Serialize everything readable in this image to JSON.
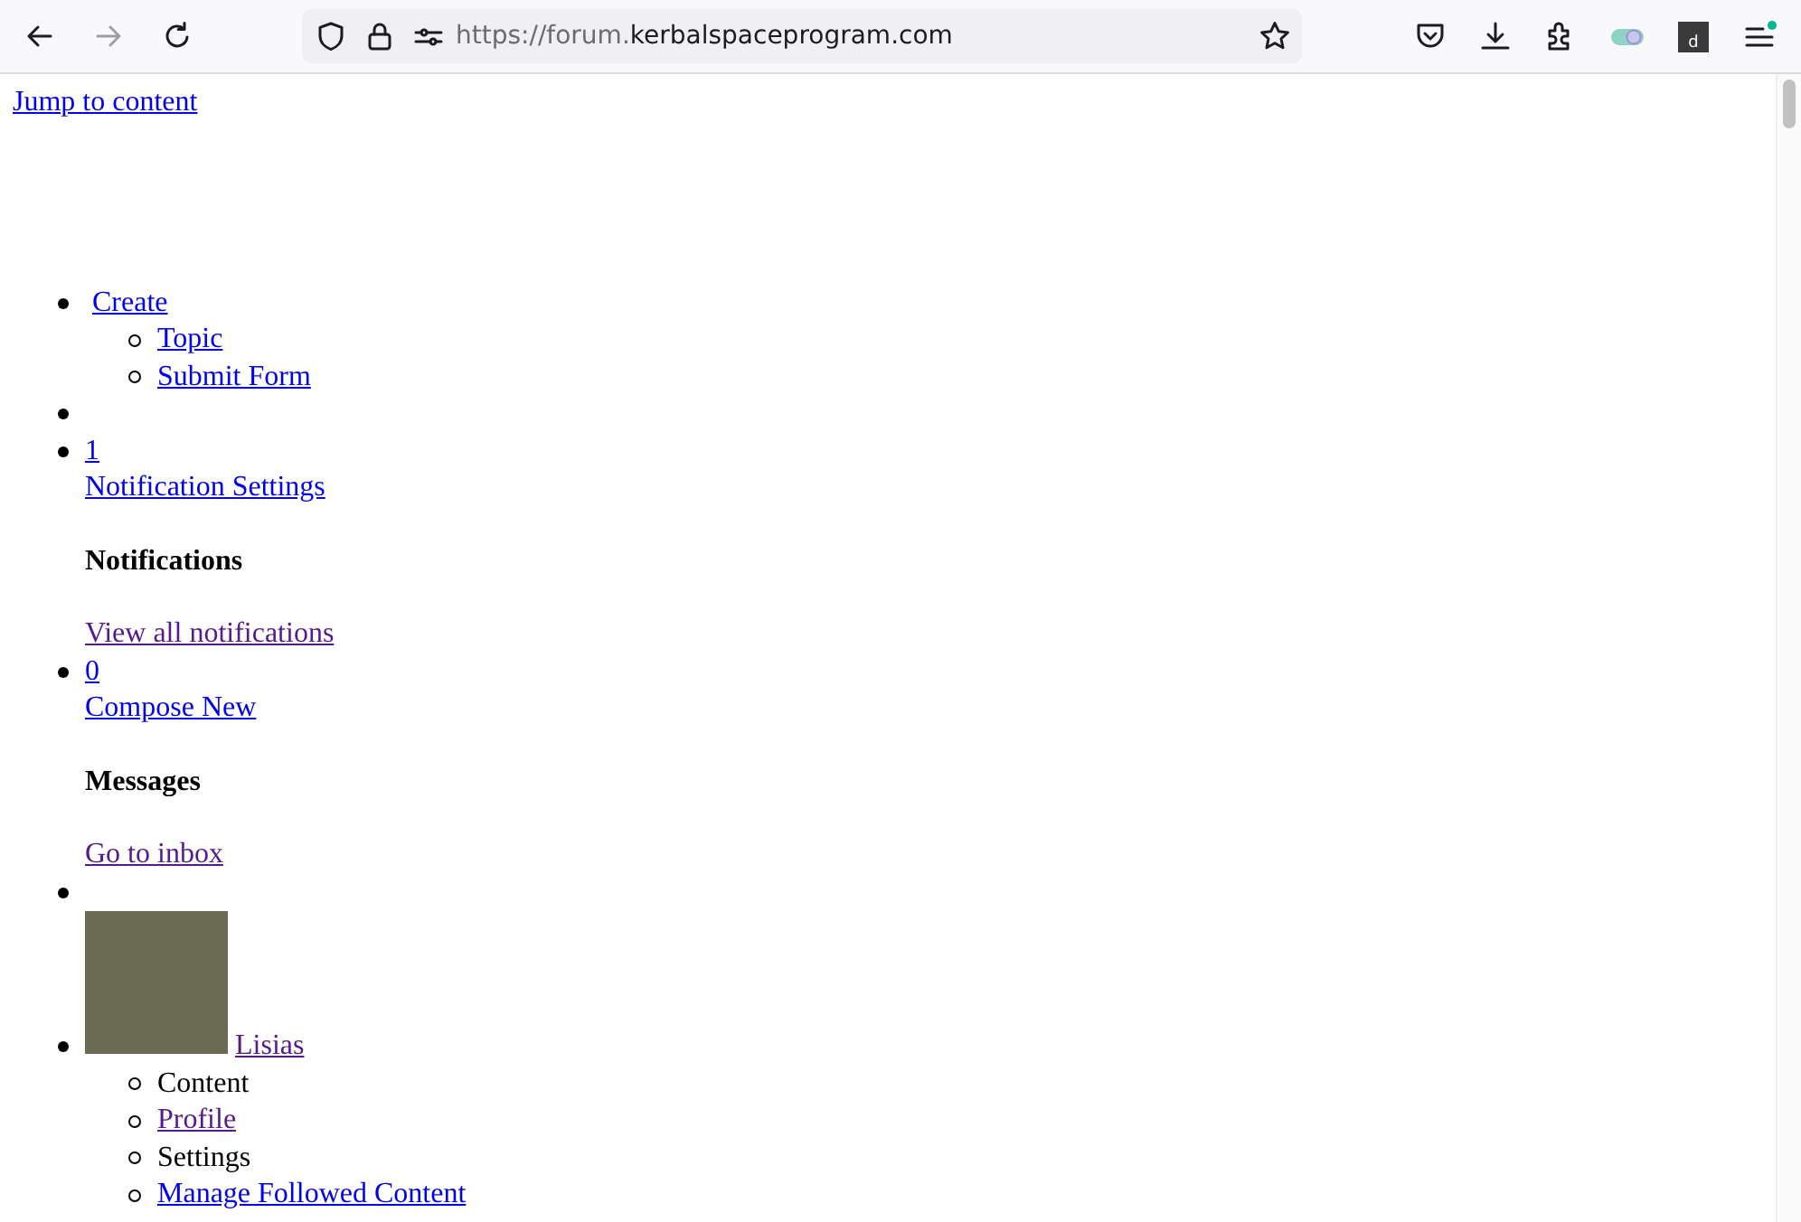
{
  "browser": {
    "back_disabled": false,
    "forward_disabled": true,
    "url_prefix": "https://forum.",
    "url_domain": "kerbalspaceprogram.com",
    "extension_letter": "d"
  },
  "page": {
    "skip_link": "Jump to content",
    "nav": [
      {
        "kind": "menu",
        "label": "Create",
        "visited": false,
        "children": [
          {
            "kind": "link",
            "label": "Topic",
            "visited": false
          },
          {
            "kind": "link",
            "label": "Submit Form",
            "visited": false
          }
        ]
      },
      {
        "kind": "empty"
      },
      {
        "kind": "panel",
        "count": "1",
        "action": "Notification Settings",
        "heading": "Notifications",
        "footer": "View all notifications",
        "footer_visited": true
      },
      {
        "kind": "panel",
        "count": "0",
        "action": "Compose New",
        "heading": "Messages",
        "footer": "Go to inbox",
        "footer_visited": true
      },
      {
        "kind": "empty"
      },
      {
        "kind": "user",
        "label": "Lisias",
        "visited": true,
        "children": [
          {
            "kind": "text",
            "label": "Content"
          },
          {
            "kind": "link",
            "label": "Profile",
            "visited": true
          },
          {
            "kind": "text",
            "label": "Settings"
          },
          {
            "kind": "link",
            "label": "Manage Followed Content",
            "visited": false
          }
        ]
      }
    ]
  }
}
